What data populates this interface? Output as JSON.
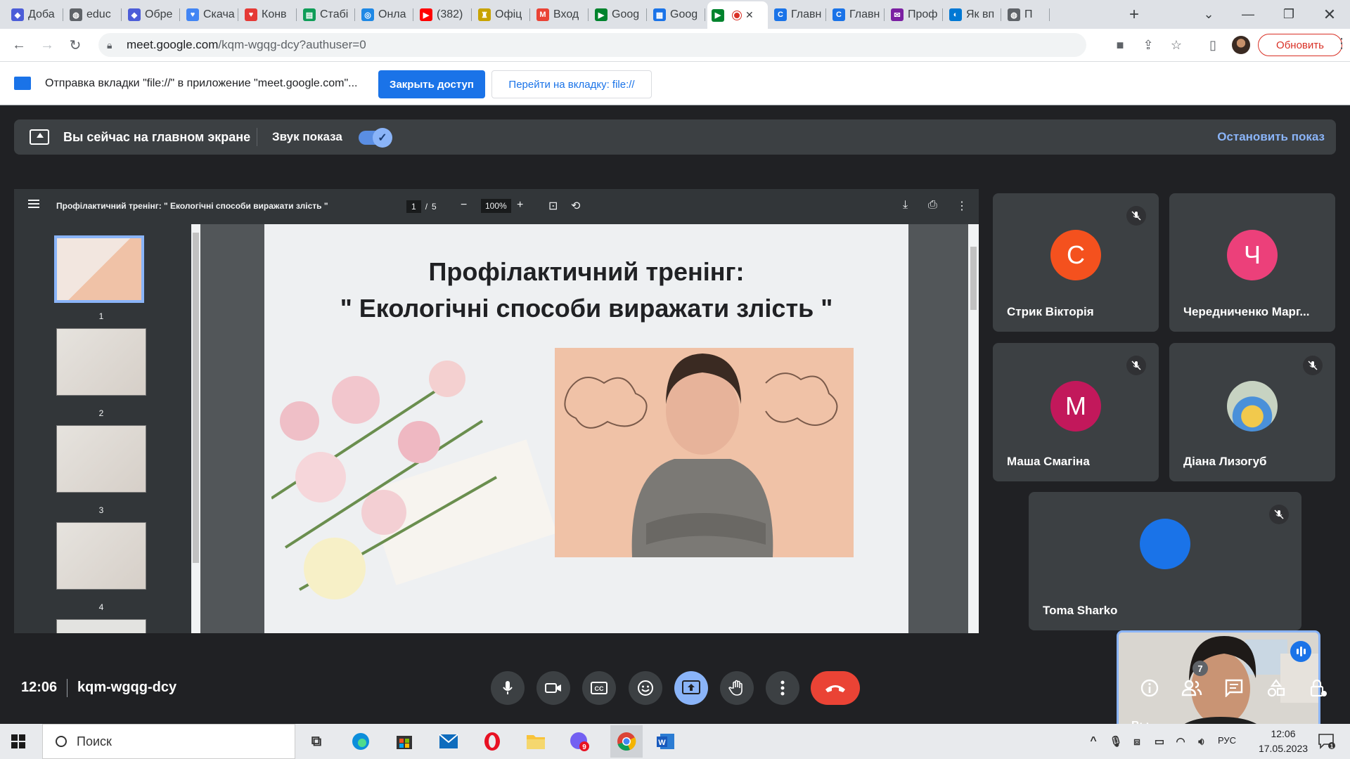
{
  "browser": {
    "tabs": [
      {
        "label": "Доба",
        "icon": "shield-icon",
        "color": "#4c5dd8"
      },
      {
        "label": "educ",
        "icon": "globe-icon",
        "color": "#5f6368"
      },
      {
        "label": "Обре",
        "icon": "shield-icon",
        "color": "#4c5dd8"
      },
      {
        "label": "Скача",
        "icon": "heart-icon",
        "color": "#4285f4"
      },
      {
        "label": "Конв",
        "icon": "heart-icon",
        "color": "#e53935"
      },
      {
        "label": "Стабі",
        "icon": "chart-icon",
        "color": "#0f9d58"
      },
      {
        "label": "Онла",
        "icon": "ring-icon",
        "color": "#1e88e5"
      },
      {
        "label": "(382)",
        "icon": "youtube-icon",
        "color": "#ff0000"
      },
      {
        "label": "Офіц",
        "icon": "emblem-icon",
        "color": "#c8a300"
      },
      {
        "label": "Вход",
        "icon": "gmail-icon",
        "color": "#ea4335"
      },
      {
        "label": "Goog",
        "icon": "meet-icon",
        "color": "#00832d"
      },
      {
        "label": "Goog",
        "icon": "calendar-icon",
        "color": "#1a73e8"
      },
      {
        "label": "",
        "icon": "meet-icon",
        "color": "#00832d"
      },
      {
        "label": "Главн",
        "icon": "c-icon",
        "color": "#1a73e8"
      },
      {
        "label": "Главн",
        "icon": "c-icon",
        "color": "#1a73e8"
      },
      {
        "label": "Проф",
        "icon": "chat-icon",
        "color": "#7b1fa2"
      },
      {
        "label": "Як вп",
        "icon": "edge-icon",
        "color": "#0078d4"
      },
      {
        "label": "П",
        "icon": "globe-icon",
        "color": "#5f6368"
      }
    ],
    "url_host": "meet.google.com",
    "url_path": "/kqm-wgqg-dcy?authuser=0",
    "update_label": "Обновить"
  },
  "infobar": {
    "text": "Отправка вкладки \"file://\" в приложение \"meet.google.com\"...",
    "close_access": "Закрыть доступ",
    "goto_tab": "Перейти на вкладку: file://"
  },
  "presenting": {
    "title": "Вы сейчас на главном экране",
    "sound_label": "Звук показа",
    "sound_on": true,
    "stop_label": "Остановить показ"
  },
  "pdf": {
    "title": "Профілактичний тренінг: \" Екологічні способи виражати злість \"",
    "current_page": "1",
    "total_pages": "5",
    "page_sep": "/",
    "zoom": "100%",
    "thumbnails": [
      "1",
      "2",
      "3",
      "4"
    ],
    "slide_title_line1": "Профілактичний тренінг:",
    "slide_title_line2": "\" Екологічні способи виражати злість \""
  },
  "participants": [
    {
      "initial": "С",
      "name": "Стрик Вікторія",
      "color": "#f4511e",
      "muted": true
    },
    {
      "initial": "Ч",
      "name": "Чередниченко Марг...",
      "color": "#ec407a",
      "muted": false
    },
    {
      "initial": "М",
      "name": "Маша Смагіна",
      "color": "#c2185b",
      "muted": true
    },
    {
      "initial": "",
      "name": "Діана Лизогуб",
      "color": "#9aa0a6",
      "muted": true
    },
    {
      "initial": "",
      "name": "Toma Sharko",
      "color": "#1a73e8",
      "muted": true
    }
  ],
  "self": {
    "label": "Вы"
  },
  "controls": {
    "time": "12:06",
    "meeting_code": "kqm-wgqg-dcy",
    "people_count": "7"
  },
  "taskbar": {
    "search_placeholder": "Поиск",
    "viber_badge": "9",
    "lang": "РУС",
    "time": "12:06",
    "date": "17.05.2023",
    "notif_count": "1"
  }
}
